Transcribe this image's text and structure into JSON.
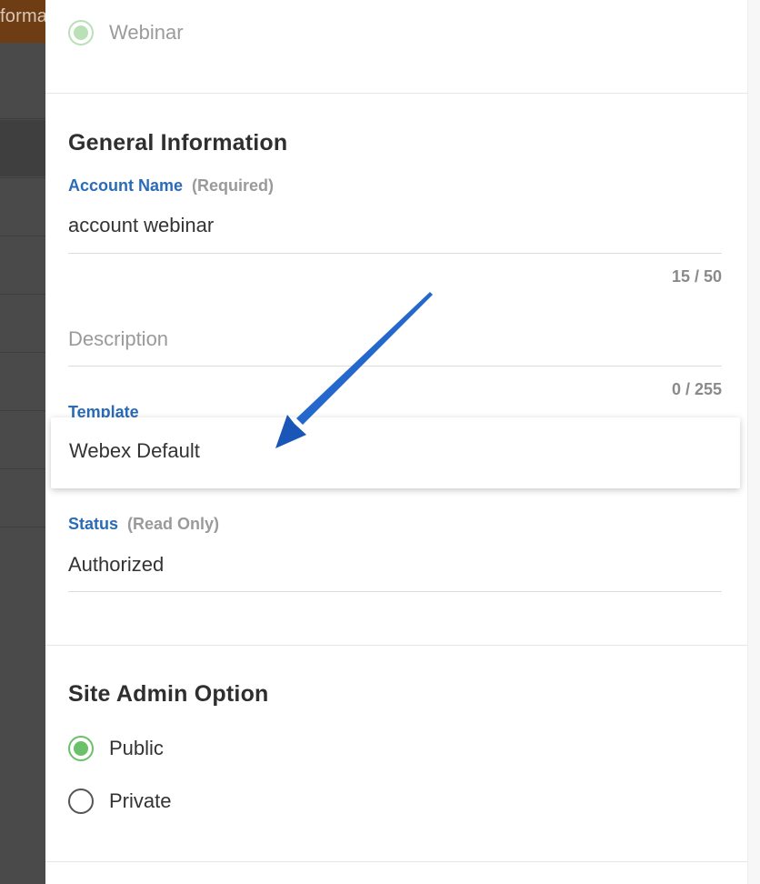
{
  "background": {
    "partial_text": "forma"
  },
  "event_type": {
    "option_label": "Webinar"
  },
  "general_information": {
    "title": "General Information",
    "account_name": {
      "label": "Account Name",
      "note": "(Required)",
      "value": "account webinar",
      "counter": "15 / 50"
    },
    "description": {
      "placeholder": "Description",
      "counter": "0 / 255"
    },
    "template": {
      "label": "Template",
      "value": "Webex Default"
    },
    "status": {
      "label": "Status",
      "note": "(Read Only)",
      "value": "Authorized"
    }
  },
  "site_admin_option": {
    "title": "Site Admin Option",
    "options": [
      {
        "label": "Public",
        "selected": true
      },
      {
        "label": "Private",
        "selected": false
      }
    ]
  },
  "colors": {
    "accent_blue": "#2a6bb8",
    "radio_green": "#6cc06a",
    "arrow_blue": "#1a5fc4"
  },
  "icons": {
    "annotation": "arrow-annotation-icon"
  }
}
